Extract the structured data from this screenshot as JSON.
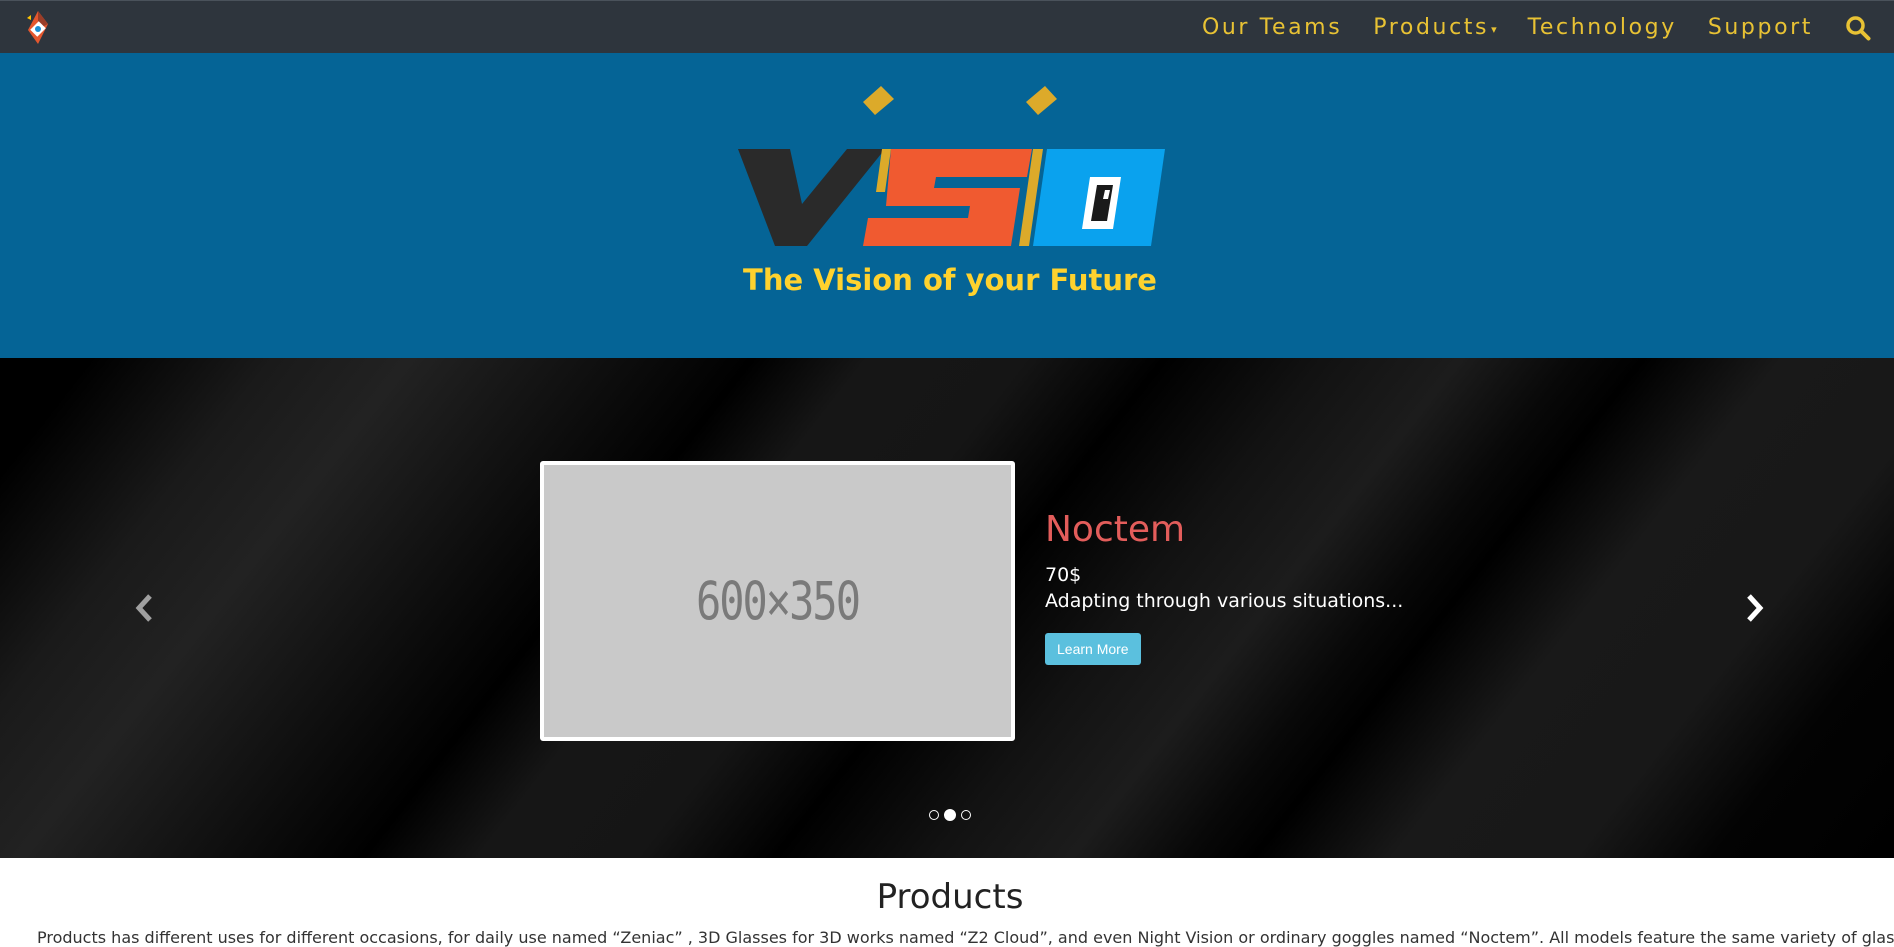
{
  "navbar": {
    "brand_icon": "visi-logo-icon",
    "items": [
      {
        "label": "Our Teams"
      },
      {
        "label": "Products"
      },
      {
        "label": "Technology"
      },
      {
        "label": "Support"
      }
    ],
    "products_caret": "▾",
    "search_icon": "search-icon",
    "colors": {
      "background": "#2e353d",
      "link": "#e8c234"
    }
  },
  "hero": {
    "logo_text": "VSI",
    "tagline": "The Vision of your Future",
    "colors": {
      "background": "#056496",
      "tagline": "#ffd22e"
    }
  },
  "carousel": {
    "image_placeholder": "600×350",
    "slide": {
      "title": "Noctem",
      "price": "70$",
      "description": "Adapting through various situations...",
      "button_label": "Learn More"
    },
    "prev_icon": "chevron-left-icon",
    "next_icon": "chevron-right-icon",
    "indicators_count": 3,
    "active_index": 1,
    "colors": {
      "title": "#e35d5b",
      "button": "#5bc0de"
    }
  },
  "products": {
    "title": "Products",
    "description": "Products has different uses for different occasions, for daily use named “Zeniac” , 3D Glasses for 3D works named “Z2 Cloud”, and even Night Vision or ordinary goggles named “Noctem”. All models feature the same variety of glass,"
  }
}
